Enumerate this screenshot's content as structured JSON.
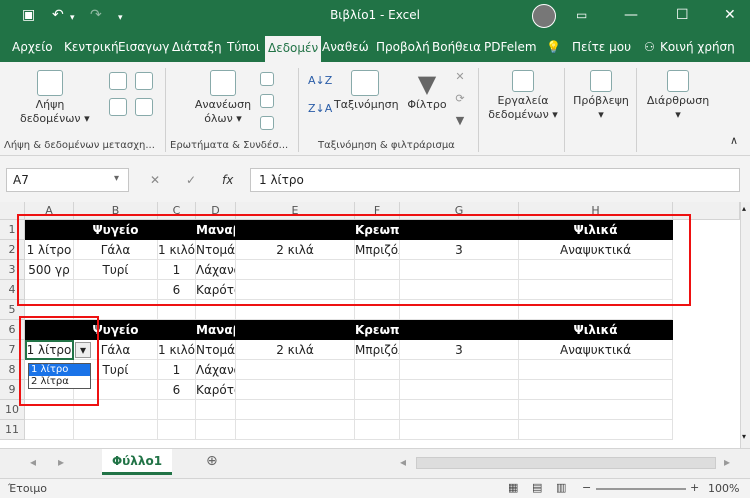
{
  "title": "Βιβλίο1 - Excel",
  "titlebar_icons": [
    "save-icon",
    "undo-icon",
    "redo-icon",
    "customize-icon"
  ],
  "tabs": [
    "Αρχείο",
    "Κεντρική",
    "Εισαγωγ",
    "Διάταξη",
    "Τύποι",
    "Δεδομέν",
    "Αναθεώ",
    "Προβολή",
    "Βοήθεια",
    "PDFelem"
  ],
  "tell_me": "Πείτε μου",
  "share": "Κοινή χρήση",
  "ribbon": {
    "get_data_1": "Λήψη",
    "get_data_2": "δεδομένων ▾",
    "refresh_1": "Ανανέωση",
    "refresh_2": "όλων ▾",
    "sort": "Ταξινόμηση",
    "filter": "Φίλτρο",
    "tools_1": "Εργαλεία",
    "tools_2": "δεδομένων ▾",
    "forecast_1": "Πρόβλεψη",
    "forecast_2": "▾",
    "outline_1": "Διάρθρωση",
    "outline_2": "▾",
    "group1": "Λήψη & δεδομένων μετασχη...",
    "group2": "Ερωτήματα & Συνδέσ...",
    "group3": "Ταξινόμηση & φιλτράρισμα"
  },
  "namebox": "A7",
  "formula": "1 λίτρο",
  "fx": "fx",
  "columns": [
    "A",
    "B",
    "C",
    "D",
    "E",
    "F",
    "G",
    "H"
  ],
  "rows": [
    "1",
    "2",
    "3",
    "4",
    "5",
    "6",
    "7",
    "8",
    "9",
    "10",
    "11"
  ],
  "table1": {
    "headers": [
      "",
      "Ψυγείο",
      "",
      "Μαναβική",
      "",
      "Κρεωπολείο",
      "",
      "Ψιλικά"
    ],
    "data": [
      [
        "1 λίτρο",
        "Γάλα",
        "1 κιλό",
        "Ντομάτες",
        "2 κιλά",
        "Μπριζόλες",
        "3",
        "Αναψυκτικά"
      ],
      [
        "500 γρ",
        "Τυρί",
        "1",
        "Λάχανο",
        "",
        "",
        "",
        ""
      ],
      [
        "",
        "",
        "6",
        "Καρότα",
        "",
        "",
        "",
        ""
      ]
    ]
  },
  "table2": {
    "headers": [
      "",
      "Ψυγείο",
      "",
      "Μαναβική",
      "",
      "Κρεωπολείο",
      "",
      "Ψιλικά"
    ],
    "data": [
      [
        "1 λίτρο",
        "Γάλα",
        "1 κιλό",
        "Ντομάτες",
        "2 κιλά",
        "Μπριζόλες",
        "3",
        "Αναψυκτικά"
      ],
      [
        "",
        "Τυρί",
        "1",
        "Λάχανο",
        "",
        "",
        "",
        ""
      ],
      [
        "",
        "",
        "6",
        "Καρότα",
        "",
        "",
        "",
        ""
      ]
    ]
  },
  "dropdown_options": [
    "1 λίτρο",
    "2 λίτρα"
  ],
  "sheet_tab": "Φύλλο1",
  "status": "Έτοιμο",
  "zoom": "100%"
}
